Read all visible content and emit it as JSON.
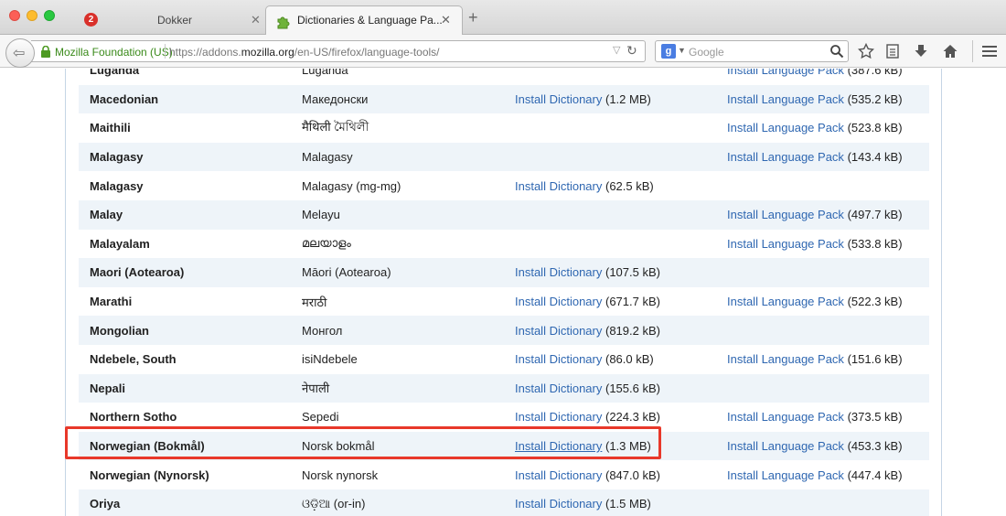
{
  "window": {
    "notification_count": "2",
    "tabs": [
      {
        "title": "Dokker",
        "close": "✕"
      },
      {
        "title": "Dictionaries & Language Pa...",
        "close": "✕"
      }
    ],
    "new_tab": "+"
  },
  "navbar": {
    "identity": "Mozilla Foundation (US)",
    "url_prefix": "https://addons.",
    "url_domain": "mozilla.org",
    "url_path": "/en-US/firefox/language-tools/",
    "search_placeholder": "Google",
    "search_engine_letter": "g"
  },
  "labels": {
    "install_dictionary": "Install Dictionary",
    "install_language_pack": "Install Language Pack"
  },
  "languages": [
    {
      "name": "Luganda",
      "native": "Luganda",
      "dict_size": "",
      "pack_size": "(387.6 kB)"
    },
    {
      "name": "Macedonian",
      "native": "Македонски",
      "dict_size": "(1.2 MB)",
      "pack_size": "(535.2 kB)"
    },
    {
      "name": "Maithili",
      "native": "मैथिली মৈথিলী",
      "dict_size": "",
      "pack_size": "(523.8 kB)"
    },
    {
      "name": "Malagasy",
      "native": "Malagasy",
      "dict_size": "",
      "pack_size": "(143.4 kB)"
    },
    {
      "name": "Malagasy",
      "native": "Malagasy (mg-mg)",
      "dict_size": "(62.5 kB)",
      "pack_size": ""
    },
    {
      "name": "Malay",
      "native": "Melayu",
      "dict_size": "",
      "pack_size": "(497.7 kB)"
    },
    {
      "name": "Malayalam",
      "native": "മലയാളം",
      "dict_size": "",
      "pack_size": "(533.8 kB)"
    },
    {
      "name": "Maori (Aotearoa)",
      "native": "Māori (Aotearoa)",
      "dict_size": "(107.5 kB)",
      "pack_size": ""
    },
    {
      "name": "Marathi",
      "native": "मराठी",
      "dict_size": "(671.7 kB)",
      "pack_size": "(522.3 kB)"
    },
    {
      "name": "Mongolian",
      "native": "Монгол",
      "dict_size": "(819.2 kB)",
      "pack_size": ""
    },
    {
      "name": "Ndebele, South",
      "native": "isiNdebele",
      "dict_size": "(86.0 kB)",
      "pack_size": "(151.6 kB)"
    },
    {
      "name": "Nepali",
      "native": "नेपाली",
      "dict_size": "(155.6 kB)",
      "pack_size": ""
    },
    {
      "name": "Northern Sotho",
      "native": "Sepedi",
      "dict_size": "(224.3 kB)",
      "pack_size": "(373.5 kB)"
    },
    {
      "name": "Norwegian (Bokmål)",
      "native": "Norsk bokmål",
      "dict_size": "(1.3 MB)",
      "pack_size": "(453.3 kB)",
      "highlighted": true
    },
    {
      "name": "Norwegian (Nynorsk)",
      "native": "Norsk nynorsk",
      "dict_size": "(847.0 kB)",
      "pack_size": "(447.4 kB)"
    },
    {
      "name": "Oriya",
      "native": "ଓଡ଼ିଆ (or-in)",
      "dict_size": "(1.5 MB)",
      "pack_size": ""
    }
  ],
  "colors": {
    "link": "#2f67b1",
    "stripe": "#eef4f9",
    "highlight": "#e8382a",
    "secure_identity": "#3a8a1a"
  }
}
